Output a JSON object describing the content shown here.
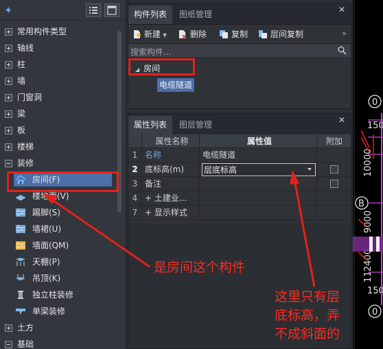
{
  "left_panel": {
    "tree": [
      {
        "label": "常用构件类型",
        "expanded": false
      },
      {
        "label": "轴线",
        "expanded": false
      },
      {
        "label": "柱",
        "expanded": false
      },
      {
        "label": "墙",
        "expanded": false
      },
      {
        "label": "门窗洞",
        "expanded": false
      },
      {
        "label": "梁",
        "expanded": false
      },
      {
        "label": "板",
        "expanded": false
      },
      {
        "label": "楼梯",
        "expanded": false
      },
      {
        "label": "装修",
        "expanded": true
      }
    ],
    "decoration_children": [
      {
        "label": "房间(F)",
        "icon": "room-icon",
        "selected": true
      },
      {
        "label": "楼地面(V)",
        "icon": "floor-icon"
      },
      {
        "label": "踢脚(S)",
        "icon": "skirting-icon"
      },
      {
        "label": "墙裙(U)",
        "icon": "dado-icon"
      },
      {
        "label": "墙面(QM)",
        "icon": "wall-surface-icon"
      },
      {
        "label": "天棚(P)",
        "icon": "ceiling-icon"
      },
      {
        "label": "吊顶(K)",
        "icon": "suspended-ceiling-icon"
      },
      {
        "label": "独立柱装修",
        "icon": "column-decoration-icon"
      },
      {
        "label": "单梁装修",
        "icon": "beam-decoration-icon"
      }
    ],
    "tree_after": [
      {
        "label": "土方",
        "expanded": false
      },
      {
        "label": "基础",
        "expanded": false
      }
    ]
  },
  "component_panel": {
    "tabs": [
      "构件列表",
      "图纸管理"
    ],
    "toolbar": {
      "new": "新建",
      "delete": "删除",
      "copy": "复制",
      "layer_copy": "层间复制"
    },
    "search_placeholder": "搜索构件...",
    "tree_root": "房间",
    "tree_child": "电缆隧道"
  },
  "property_panel": {
    "tabs": [
      "属性列表",
      "图层管理"
    ],
    "headers": {
      "name": "属性名称",
      "value": "属性值",
      "extra": "附加"
    },
    "rows": [
      {
        "num": "1",
        "name": "名称",
        "value": "电缆隧道",
        "highlight": true,
        "checkbox": false
      },
      {
        "num": "2",
        "name": "底标高(m)",
        "value": "层底标高",
        "dropdown": true,
        "checkbox": true
      },
      {
        "num": "3",
        "name": "备注",
        "value": "",
        "checkbox": true
      },
      {
        "num": "4",
        "name": "+ 土建业...",
        "value": "",
        "checkbox": false
      },
      {
        "num": "7",
        "name": "+ 显示样式",
        "value": "",
        "checkbox": false
      }
    ]
  },
  "drawing_labels": {
    "a": "0",
    "b": "150",
    "c": "B",
    "d": "0",
    "e": "150",
    "f": "0",
    "vertical_1": "10000",
    "vertical_2": "9000",
    "vertical_3": "2400",
    "vertical_4": "11"
  },
  "annotations": {
    "left": "是房间这个构件",
    "right_lines": [
      "这里只有层",
      "底标高，弄",
      "不成斜面的"
    ]
  },
  "colors": {
    "accent_red": "#e3221b",
    "selection_blue": "#4d6ea8",
    "link_blue": "#6fa3e6"
  }
}
